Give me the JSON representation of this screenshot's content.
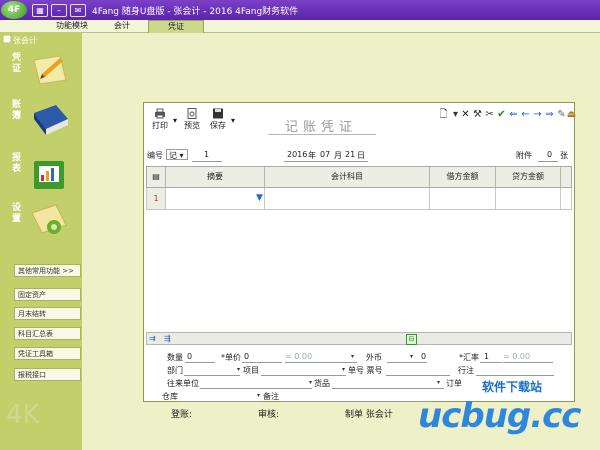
{
  "titlebar": {
    "logo": "4F",
    "title": "4Fang 随身U盘版 - 张会计 - 2016 4Fang财务软件"
  },
  "menubar": {
    "module": "功能模块",
    "accounting": "会计",
    "voucher": "凭证"
  },
  "sidebar": {
    "user": "张会计",
    "nav": [
      {
        "label": "凭证",
        "icon": "pencil-paper-icon"
      },
      {
        "label": "账簿",
        "icon": "book-icon"
      },
      {
        "label": "报表",
        "icon": "chart-report-icon"
      },
      {
        "label": "设置",
        "icon": "gear-folder-icon"
      }
    ],
    "buttons": [
      "其他常用功能 >>",
      "固定资产",
      "月末结转",
      "科目汇总表",
      "凭证工具箱",
      "报税接口"
    ]
  },
  "toolbar": {
    "print": "打印",
    "preview": "预览",
    "save": "保存"
  },
  "voucher": {
    "title": "记账凭证",
    "number_label": "编号",
    "number_type": "记",
    "number": "1",
    "year": "2016",
    "year_unit": "年",
    "month": "07",
    "month_unit": "月",
    "day": "21",
    "day_unit": "日",
    "attachment_label": "附件",
    "attachment_count": "0",
    "attachment_unit": "张"
  },
  "grid": {
    "headers": [
      "摘要",
      "会计科目",
      "借方金额",
      "贷方金额"
    ],
    "rows": [
      {
        "no": "1",
        "summary": "",
        "account": "",
        "debit": "",
        "credit": ""
      }
    ]
  },
  "details": {
    "quantity_label": "数量",
    "quantity": "0",
    "unit_price_label": "*单价",
    "unit_price": "0",
    "amount_eq": "= 0.00",
    "currency_label": "外币",
    "currency_value": "0",
    "exchange_label": "*汇率",
    "exchange_value": "1",
    "exchange_eq": "= 0.00",
    "dept_label": "部门",
    "project_label": "项目",
    "bill_label": "单号 票号",
    "bank_label": "行注",
    "contact_label": "往来单位",
    "goods_label": "货品",
    "extra_label": "订单",
    "warehouse_label": "仓库",
    "note_label": "备注"
  },
  "signatures": {
    "posted": "登账:",
    "reviewed": "审核:",
    "maker": "制单 张会计"
  },
  "watermark": {
    "site": "软件下载站",
    "brand": "ucbug.cc",
    "side": "4K"
  },
  "colors": {
    "titlebar": "#6a31b8",
    "sidebar": "#c2cf6a",
    "background": "#eef0c8",
    "brand": "#2f86dd",
    "arrow": "#1f5fd0"
  }
}
